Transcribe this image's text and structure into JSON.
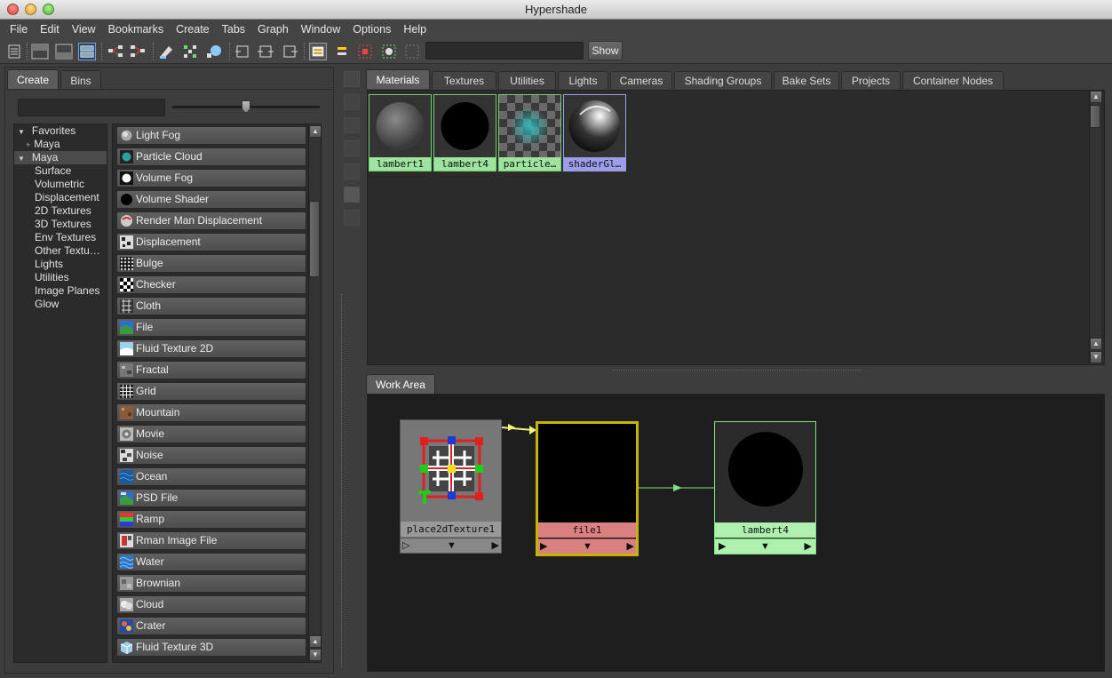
{
  "window": {
    "title": "Hypershade"
  },
  "menu": [
    "File",
    "Edit",
    "View",
    "Bookmarks",
    "Create",
    "Tabs",
    "Graph",
    "Window",
    "Options",
    "Help"
  ],
  "toolbar": {
    "search_value": "",
    "show_label": "Show"
  },
  "left_panel": {
    "tabs": [
      "Create",
      "Bins"
    ],
    "filter_value": "",
    "tree": [
      {
        "label": "Favorites",
        "expanded": true,
        "level": 0
      },
      {
        "label": "Maya",
        "expanded": false,
        "level": 1
      },
      {
        "label": "Maya",
        "expanded": true,
        "level": 0,
        "selected": true
      },
      {
        "label": "Surface",
        "level": 1
      },
      {
        "label": "Volumetric",
        "level": 1
      },
      {
        "label": "Displacement",
        "level": 1
      },
      {
        "label": "2D Textures",
        "level": 1
      },
      {
        "label": "3D Textures",
        "level": 1
      },
      {
        "label": "Env Textures",
        "level": 1
      },
      {
        "label": "Other Textu…",
        "level": 1
      },
      {
        "label": "Lights",
        "level": 1
      },
      {
        "label": "Utilities",
        "level": 1
      },
      {
        "label": "Image Planes",
        "level": 1
      },
      {
        "label": "Glow",
        "level": 1
      }
    ],
    "nodes": [
      {
        "label": "Light Fog",
        "icon": "light-fog-icon"
      },
      {
        "label": "Particle Cloud",
        "icon": "particle-cloud-icon"
      },
      {
        "label": "Volume Fog",
        "icon": "volume-fog-icon"
      },
      {
        "label": "Volume Shader",
        "icon": "volume-shader-icon"
      },
      {
        "label": "Render Man Displacement",
        "icon": "renderman-displacement-icon"
      },
      {
        "label": "Displacement",
        "icon": "displacement-icon"
      },
      {
        "label": "Bulge",
        "icon": "bulge-icon"
      },
      {
        "label": "Checker",
        "icon": "checker-icon"
      },
      {
        "label": "Cloth",
        "icon": "cloth-icon"
      },
      {
        "label": "File",
        "icon": "file-icon"
      },
      {
        "label": "Fluid Texture 2D",
        "icon": "fluid-texture-2d-icon"
      },
      {
        "label": "Fractal",
        "icon": "fractal-icon"
      },
      {
        "label": "Grid",
        "icon": "grid-icon"
      },
      {
        "label": "Mountain",
        "icon": "mountain-icon"
      },
      {
        "label": "Movie",
        "icon": "movie-icon"
      },
      {
        "label": "Noise",
        "icon": "noise-icon"
      },
      {
        "label": "Ocean",
        "icon": "ocean-icon"
      },
      {
        "label": "PSD File",
        "icon": "psd-file-icon"
      },
      {
        "label": "Ramp",
        "icon": "ramp-icon"
      },
      {
        "label": "Rman Image File",
        "icon": "rman-image-file-icon"
      },
      {
        "label": "Water",
        "icon": "water-icon"
      },
      {
        "label": "Brownian",
        "icon": "brownian-icon"
      },
      {
        "label": "Cloud",
        "icon": "cloud-icon"
      },
      {
        "label": "Crater",
        "icon": "crater-icon"
      },
      {
        "label": "Fluid Texture 3D",
        "icon": "fluid-texture-3d-icon"
      }
    ]
  },
  "browser": {
    "tabs": [
      "Materials",
      "Textures",
      "Utilities",
      "Lights",
      "Cameras",
      "Shading Groups",
      "Bake Sets",
      "Projects",
      "Container Nodes"
    ],
    "active_tab": "Materials",
    "swatches": [
      {
        "label": "lambert1",
        "kind": "gray-sphere",
        "selected": false
      },
      {
        "label": "lambert4",
        "kind": "black-sphere",
        "selected": false
      },
      {
        "label": "particle…",
        "kind": "particle-checker",
        "selected": false
      },
      {
        "label": "shaderGl…",
        "kind": "glossy-sphere",
        "selected": true
      }
    ]
  },
  "work_area": {
    "tab": "Work Area",
    "nodes": [
      {
        "label": "place2dTexture1",
        "kind": "place2d"
      },
      {
        "label": "file1",
        "kind": "file"
      },
      {
        "label": "lambert4",
        "kind": "lambert"
      }
    ]
  },
  "colors": {
    "swatch_label_green": "#9ee39e",
    "swatch_label_selected": "#9c9ce8",
    "file_node_label": "#d98080",
    "file_node_border": "#c8b400",
    "lambert_label": "#aef0ae",
    "connection_yellow": "#f2f27a",
    "connection_green": "#7ee07e"
  }
}
